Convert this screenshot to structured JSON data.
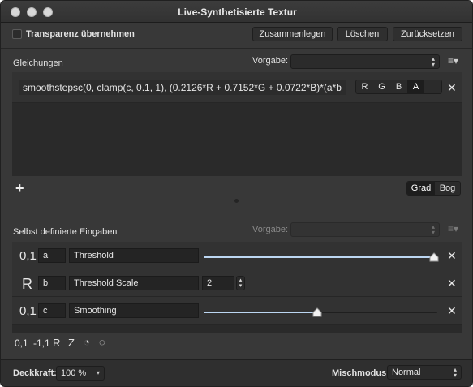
{
  "window": {
    "title": "Live-Synthetisierte Textur"
  },
  "toolbar": {
    "transparency_label": "Transparenz übernehmen",
    "merge_label": "Zusammenlegen",
    "delete_label": "Löschen",
    "reset_label": "Zurücksetzen"
  },
  "equations": {
    "section_label": "Gleichungen",
    "preset_label": "Vorgabe:",
    "preset_value": "",
    "formula": "smoothstepsc(0, clamp(c, 0.1, 1), (0.2126*R + 0.7152*G + 0.0722*B)*(a*b",
    "channels": [
      "R",
      "G",
      "B",
      "A"
    ],
    "selected_channel": "A",
    "add_label": "+",
    "angle_units": [
      "Grad",
      "Bog"
    ],
    "selected_angle_unit": "Grad"
  },
  "inputs": {
    "section_label": "Selbst definierte Eingaben",
    "preset_label": "Vorgabe:",
    "preset_value": "",
    "rows": [
      {
        "type_symbol": "0,1",
        "var": "a",
        "name": "Threshold",
        "slider_value": 1.0
      },
      {
        "type_symbol": "R",
        "var": "b",
        "name": "Threshold Scale",
        "number_value": "2"
      },
      {
        "type_symbol": "0,1",
        "var": "c",
        "name": "Smoothing",
        "slider_value": 0.5
      }
    ],
    "add_types": [
      "0,1",
      "-1,1",
      "R",
      "Z",
      "◔",
      "◌"
    ]
  },
  "footer": {
    "opacity_label": "Deckkraft:",
    "opacity_value": "100 %",
    "blend_label": "Mischmodus:",
    "blend_value": "Normal"
  },
  "colors": {
    "accent_slider": "#bcd6f2",
    "background": "#383838"
  }
}
